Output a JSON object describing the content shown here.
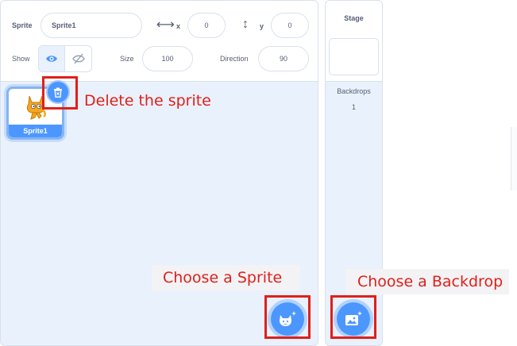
{
  "sprite_info": {
    "sprite_label": "Sprite",
    "sprite_name": "Sprite1",
    "x_label": "x",
    "x_value": "0",
    "y_label": "y",
    "y_value": "0",
    "show_label": "Show",
    "size_label": "Size",
    "size_value": "100",
    "direction_label": "Direction",
    "direction_value": "90"
  },
  "sprites": [
    {
      "name": "Sprite1",
      "selected": true
    }
  ],
  "stage": {
    "title": "Stage",
    "backdrops_label": "Backdrops",
    "backdrops_count": "1"
  },
  "annotations": {
    "delete": "Delete the sprite",
    "choose_sprite": "Choose a Sprite",
    "choose_backdrop": "Choose a Backdrop"
  },
  "colors": {
    "accent": "#4c97ff",
    "annotation": "#e0201a",
    "panel_bg": "#e9f1fc"
  },
  "icons": {
    "x_axis": "horizontal-arrows-icon",
    "y_axis": "vertical-arrows-icon",
    "show": "eye-icon",
    "hide": "eye-slash-icon",
    "delete": "trash-icon",
    "choose_sprite": "cat-plus-icon",
    "choose_backdrop": "image-plus-icon"
  }
}
